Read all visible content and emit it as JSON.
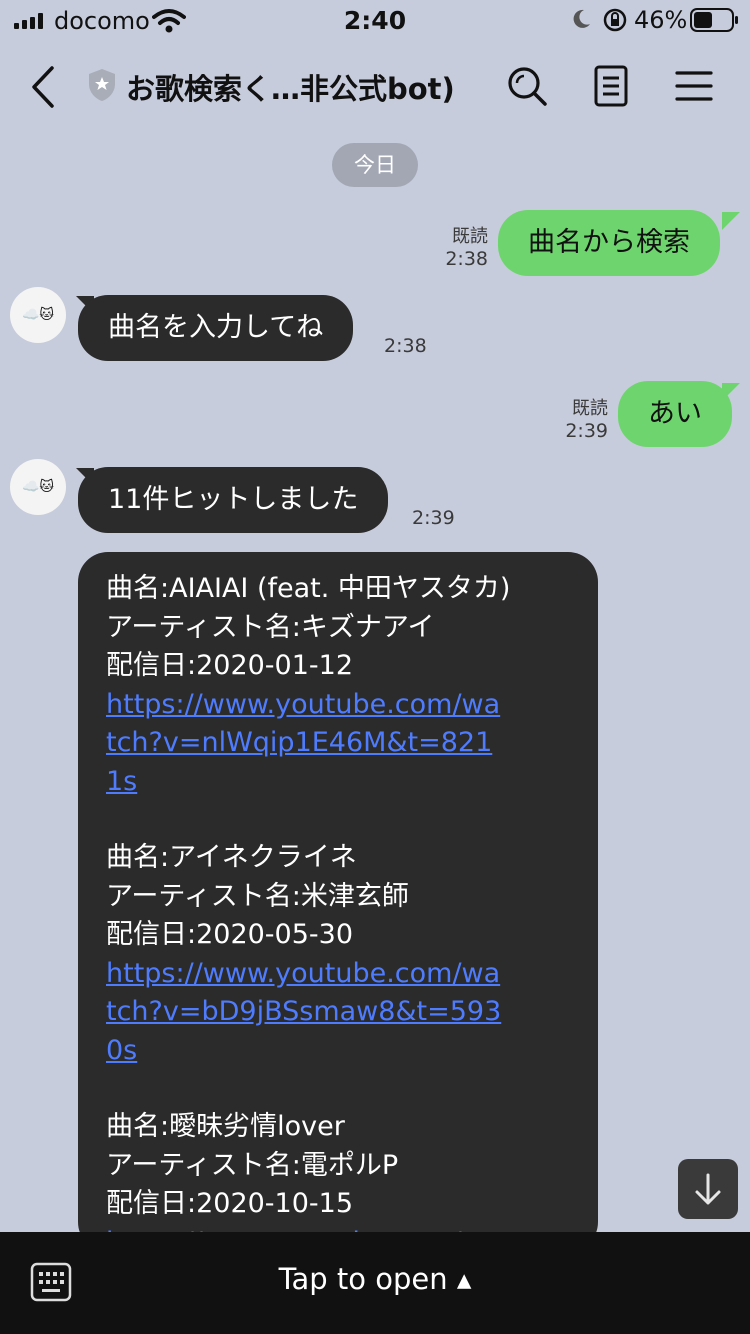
{
  "status_bar": {
    "carrier": "docomo",
    "time": "2:40",
    "battery": "46%"
  },
  "header": {
    "title": "お歌検索く…非公式bot)",
    "icons": [
      "back-icon",
      "shield-icon",
      "search-icon",
      "note-icon",
      "menu-icon"
    ]
  },
  "date_divider": "今日",
  "messages": [
    {
      "side": "out",
      "text": "曲名から検索",
      "read": "既読",
      "time": "2:38"
    },
    {
      "side": "in",
      "text": "曲名を入力してね",
      "time": "2:38",
      "avatar": "☁️🐱"
    },
    {
      "side": "out",
      "text": "あい",
      "read": "既読",
      "time": "2:39"
    },
    {
      "side": "in",
      "text": "11件ヒットしました",
      "time": "2:39",
      "avatar": "☁️🐱"
    }
  ],
  "results": [
    {
      "song": "曲名:AIAIAI (feat. 中田ヤスタカ)",
      "artist": "アーティスト名:キズナアイ",
      "date": "配信日:2020-01-12",
      "url": "https://www.youtube.com/watch?v=nlWqip1E46M&t=8211s"
    },
    {
      "song": "曲名:アイネクライネ",
      "artist": "アーティスト名:米津玄師",
      "date": "配信日:2020-05-30",
      "url": "https://www.youtube.com/watch?v=bD9jBSsmaw8&t=5930s"
    },
    {
      "song": "曲名:曖昧劣情lover",
      "artist": "アーティスト名:電ポルP",
      "date": "配信日:2020-10-15",
      "url": "https://www.youtube.com/"
    }
  ],
  "footer": {
    "tap_to_open": "Tap to open ▴"
  },
  "colors": {
    "background": "#c7ccdc",
    "incoming_bubble": "#2b2b2b",
    "outgoing_bubble": "#6ed56e",
    "link": "#4f7cff"
  }
}
